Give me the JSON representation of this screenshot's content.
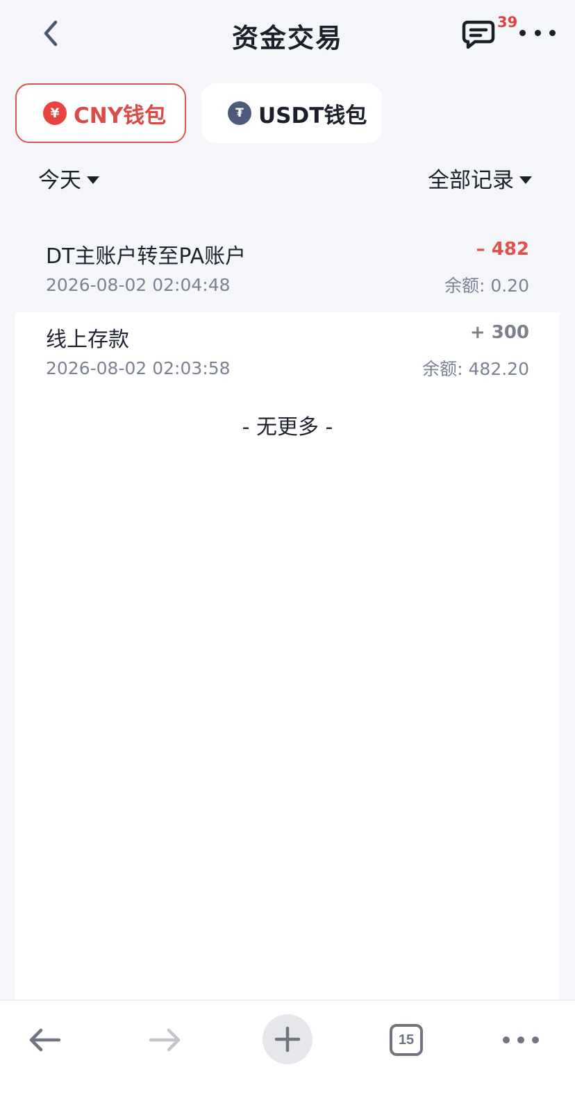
{
  "header": {
    "title": "资金交易",
    "message_count": "39",
    "back_icon": "chevron-left-icon",
    "message_icon": "chat-bubble-icon",
    "more_icon": "more-dots-icon"
  },
  "wallets": [
    {
      "label": "CNY钱包",
      "icon_text": "¥",
      "icon": "yuan-icon",
      "active": true
    },
    {
      "label": "USDT钱包",
      "icon_text": "₮",
      "icon": "tether-icon",
      "active": false
    }
  ],
  "filters": {
    "date_label": "今天",
    "type_label": "全部记录"
  },
  "transactions": [
    {
      "name": "DT主账户转至PA账户",
      "time": "2026-08-02 02:04:48",
      "amount": "– 482",
      "balance": "余额:  0.20",
      "direction": "out"
    },
    {
      "name": "线上存款",
      "time": "2026-08-02 02:03:58",
      "amount": "+ 300",
      "balance": "余额:  482.20",
      "direction": "in"
    }
  ],
  "list_end_text": "- 无更多 -",
  "toolbar": {
    "tab_count": "15",
    "icons": [
      "back-arrow-icon",
      "forward-arrow-icon",
      "plus-icon",
      "tabs-icon",
      "more-dots-icon"
    ]
  },
  "colors": {
    "accent_red": "#e0504a",
    "background": "#f5f6fa",
    "text_secondary": "#7b8294"
  }
}
